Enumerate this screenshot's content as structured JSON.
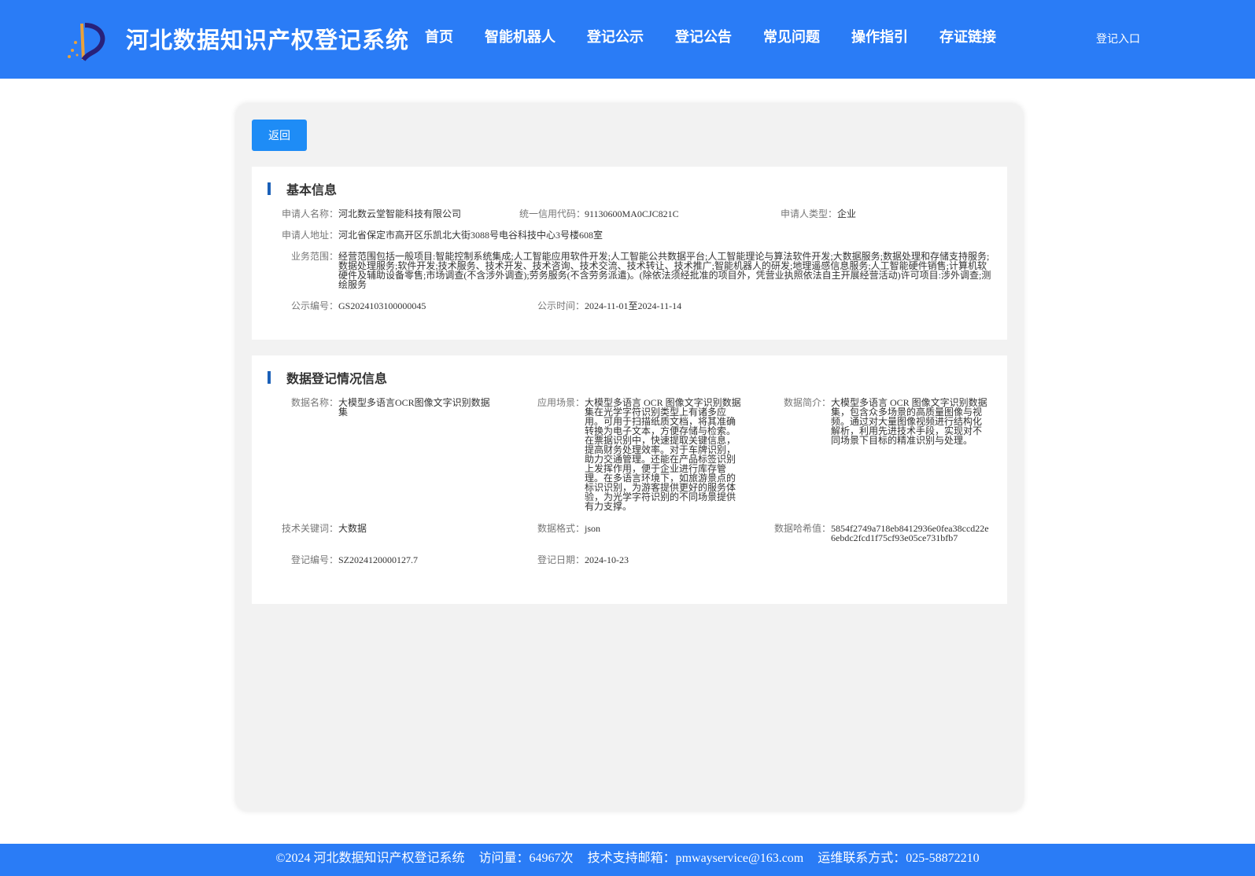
{
  "header": {
    "title": "河北数据知识产权登记系统",
    "nav": [
      "首页",
      "智能机器人",
      "登记公示",
      "登记公告",
      "常见问题",
      "操作指引",
      "存证链接"
    ],
    "login": "登记入口",
    "bg_color": "#2a7cf6"
  },
  "back_label": "返回",
  "basic": {
    "title": "基本信息",
    "applicant_name_label": "申请人名称：",
    "applicant_name": "河北数云堂智能科技有限公司",
    "credit_code_label": "统一信用代码：",
    "credit_code": "91130600MA0CJC821C",
    "applicant_type_label": "申请人类型：",
    "applicant_type": "企业",
    "address_label": "申请人地址：",
    "address": "河北省保定市高开区乐凯北大街3088号电谷科技中心3号楼608室",
    "scope_label": "业务范围：",
    "scope": "经营范围包括一般项目:智能控制系统集成;人工智能应用软件开发;人工智能公共数据平台;人工智能理论与算法软件开发;大数据服务;数据处理和存储支持服务;数据处理服务;软件开发;技术服务、技术开发、技术咨询、技术交流、技术转让、技术推广;智能机器人的研发;地理遥感信息服务;人工智能硬件销售;计算机软硬件及辅助设备零售;市场调查(不含涉外调查);劳务服务(不含劳务派遣)。(除依法须经批准的项目外，凭营业执照依法自主开展经营活动)许可项目:涉外调查;测绘服务",
    "pub_no_label": "公示编号：",
    "pub_no": "GS2024103100000045",
    "pub_time_label": "公示时间：",
    "pub_time": "2024-11-01至2024-11-14"
  },
  "registration": {
    "title": "数据登记情况信息",
    "data_name_label": "数据名称：",
    "data_name": "大模型多语言OCR图像文字识别数据集",
    "scene_label": "应用场景：",
    "scene": "大模型多语言 OCR 图像文字识别数据集在光学字符识别类型上有诸多应用。可用于扫描纸质文档，将其准确转换为电子文本，方便存储与检索。在票据识别中，快速提取关键信息，提高财务处理效率。对于车牌识别，助力交通管理。还能在产品标签识别上发挥作用，便于企业进行库存管理。在多语言环境下，如旅游景点的标识识别，为游客提供更好的服务体验，为光学字符识别的不同场景提供有力支撑。",
    "intro_label": "数据简介：",
    "intro": "大模型多语言 OCR 图像文字识别数据集，包含众多场景的高质量图像与视频。通过对大量图像视频进行结构化解析，利用先进技术手段，实现对不同场景下目标的精准识别与处理。",
    "keyword_label": "技术关键词：",
    "keyword": "大数据",
    "format_label": "数据格式：",
    "format": "json",
    "hash_label": "数据哈希值：",
    "hash": "5854f2749a718eb8412936e0fea38ccd22e6ebdc2fcd1f75cf93e05ce731bfb7",
    "reg_no_label": "登记编号：",
    "reg_no": "SZ2024120000127.7",
    "reg_date_label": "登记日期：",
    "reg_date": "2024-10-23"
  },
  "footer": {
    "copyright": "©2024 河北数据知识产权登记系统",
    "visits": "访问量：64967次",
    "email": "技术支持邮箱：pmwayservice@163.com",
    "contact": "运维联系方式：025-58872210"
  }
}
